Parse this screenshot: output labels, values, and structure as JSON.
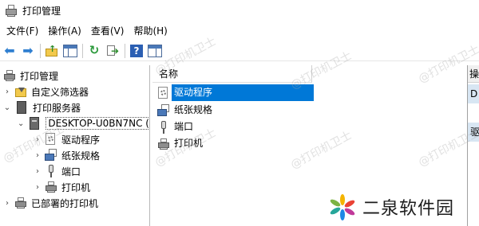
{
  "window": {
    "title": "打印管理"
  },
  "menu": [
    {
      "label": "文件(F)"
    },
    {
      "label": "操作(A)"
    },
    {
      "label": "查看(V)"
    },
    {
      "label": "帮助(H)"
    }
  ],
  "toolbar": {
    "icons": [
      "back-icon",
      "forward-icon",
      "up-folder-icon",
      "show-console-tree-icon",
      "refresh-icon",
      "export-list-icon",
      "help-icon",
      "properties-icon"
    ]
  },
  "tree": {
    "root": "打印管理",
    "custom_filters": "自定义筛选器",
    "print_servers": "打印服务器",
    "server": "DESKTOP-U0BN7NC (",
    "drivers": "驱动程序",
    "forms": "纸张规格",
    "ports": "端口",
    "printers": "打印机",
    "deployed_printers": "已部署的打印机"
  },
  "list": {
    "header_name": "名称",
    "items": [
      {
        "label": "驱动程序",
        "selected": true
      },
      {
        "label": "纸张规格",
        "selected": false
      },
      {
        "label": "端口",
        "selected": false
      },
      {
        "label": "打印机",
        "selected": false
      }
    ]
  },
  "actions": {
    "header": "操",
    "item1": "D",
    "item2": "驱"
  },
  "watermark": {
    "text": "@打印机卫士"
  },
  "brand": {
    "name": "二泉软件园"
  },
  "colors": {
    "selection": "#0078d7",
    "action_band": "#d8e6f3"
  }
}
